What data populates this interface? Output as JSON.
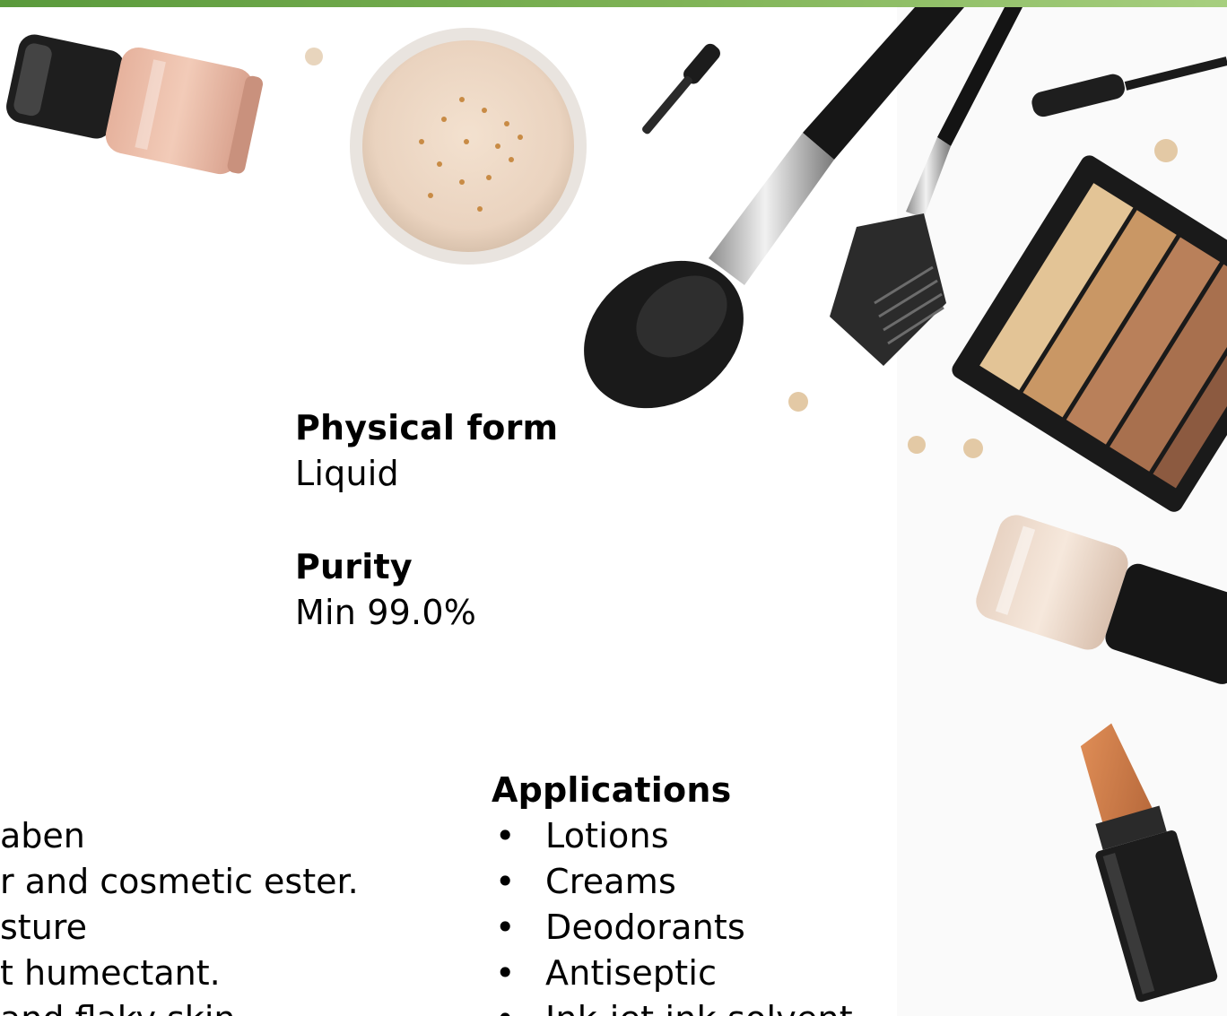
{
  "colors": {
    "accent_bar": "#6fa84a",
    "text": "#000000",
    "background": "#ffffff"
  },
  "background_image": {
    "description_icons": [
      "nail-polish",
      "loose-powder",
      "eyeshadow-applicator",
      "powder-brush",
      "brow-comb-brush",
      "mascara-wand",
      "eyeshadow-palette",
      "lipstick",
      "beads"
    ]
  },
  "specs": {
    "physical_form": {
      "label": "Physical form",
      "value": "Liquid"
    },
    "purity": {
      "label": "Purity",
      "value": "Min 99.0%"
    }
  },
  "left_column": {
    "paren_fragment": ")",
    "lines": [
      "aben",
      "r and cosmetic ester.",
      "sture",
      "t humectant.",
      "and flaky skin"
    ]
  },
  "applications": {
    "heading": "Applications",
    "items": [
      "Lotions",
      "Creams",
      "Deodorants",
      "Antiseptic",
      "Ink-jet ink solvent"
    ]
  }
}
